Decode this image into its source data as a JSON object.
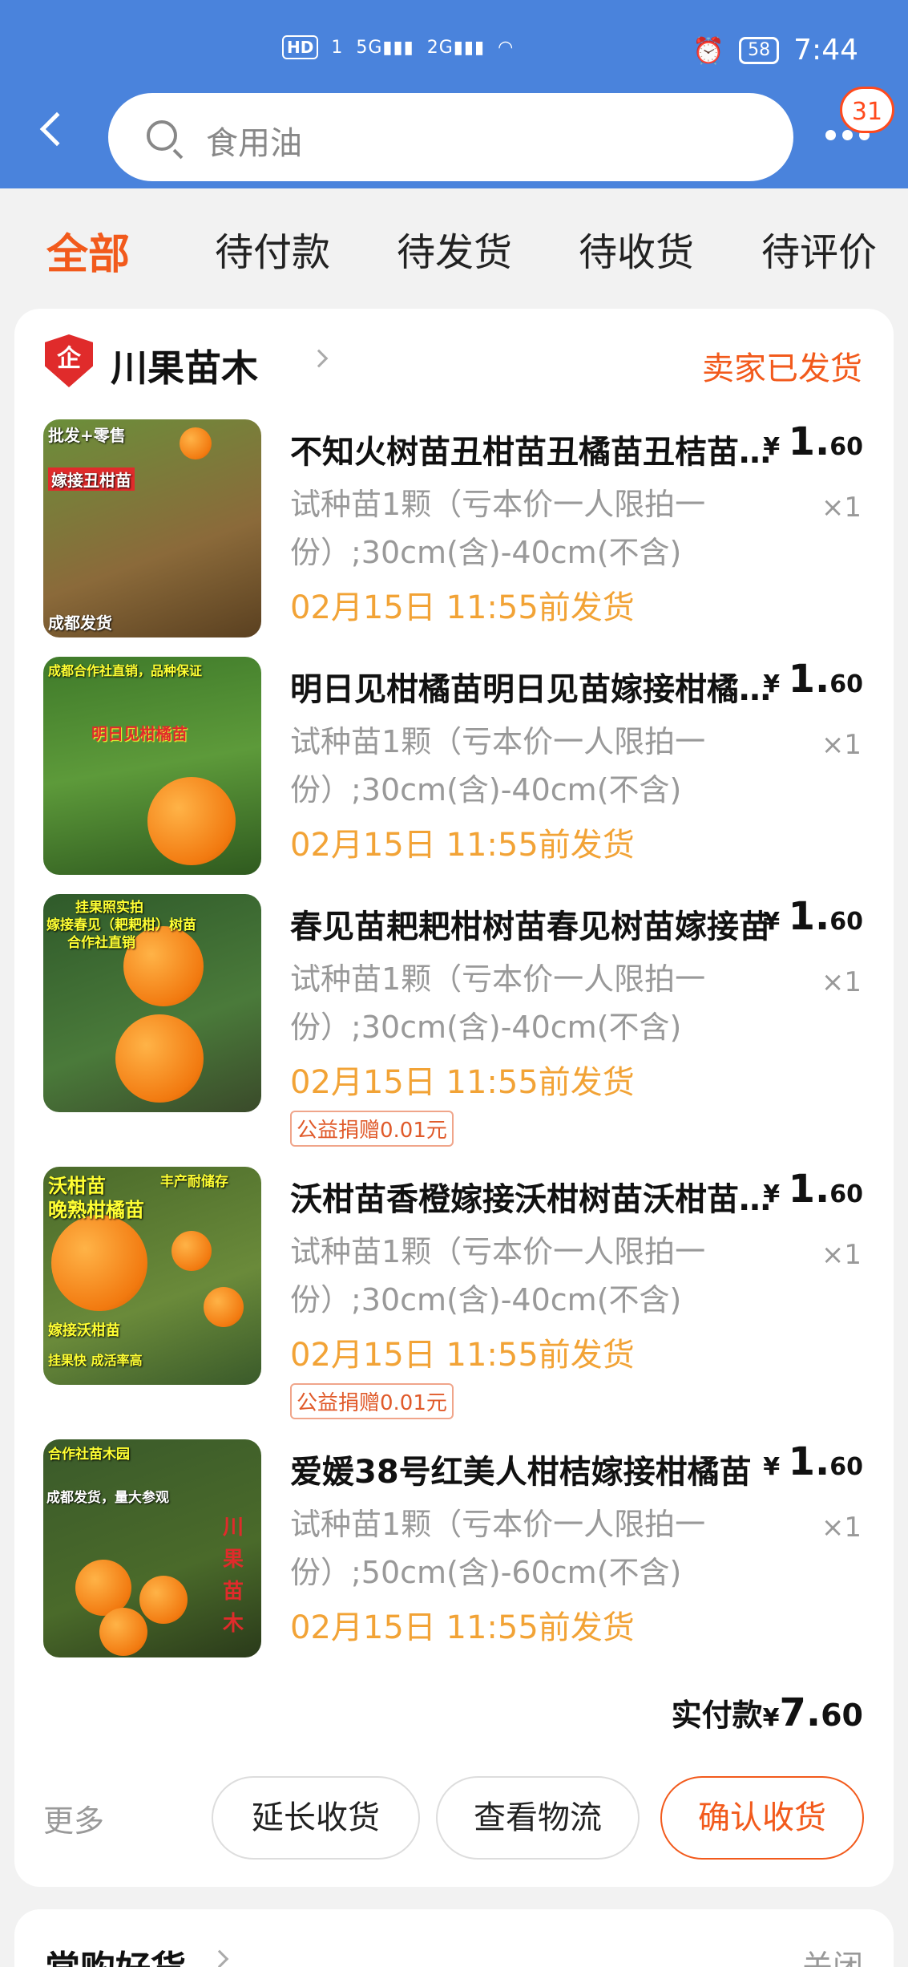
{
  "status_bar": {
    "hd": "HD",
    "sim": "1",
    "signal1": "5G",
    "signal2": "2G",
    "battery": "58",
    "time": "7:44"
  },
  "header": {
    "search_placeholder": "食用油",
    "notification_count": "31"
  },
  "tabs": [
    "全部",
    "待付款",
    "待发货",
    "待收货",
    "待评价"
  ],
  "shop": {
    "badge": "企",
    "name": "川果苗木",
    "status": "卖家已发货"
  },
  "items": [
    {
      "title": "不知火树苗丑柑苗丑橘苗丑桔苗嫁接苗",
      "price_symbol": "¥",
      "price_int": "1.",
      "price_dec": "60",
      "spec": "试种苗1颗（亏本价一人限拍一份）;30cm(含)-40cm(不含)",
      "qty": "×1",
      "ship": "02月15日 11:55前发货",
      "thumb_labels": [
        "批发+零售",
        "嫁接丑柑苗",
        "成都发货"
      ]
    },
    {
      "title": "明日见柑橘苗明日见苗嫁接柑橘树苗",
      "price_symbol": "¥",
      "price_int": "1.",
      "price_dec": "60",
      "spec": "试种苗1颗（亏本价一人限拍一份）;30cm(含)-40cm(不含)",
      "qty": "×1",
      "ship": "02月15日 11:55前发货",
      "thumb_labels": [
        "成都合作社直销，品种保证",
        "明日见柑橘苗"
      ]
    },
    {
      "title": "春见苗耙耙柑树苗春见树苗嫁接苗",
      "price_symbol": "¥",
      "price_int": "1.",
      "price_dec": "60",
      "spec": "试种苗1颗（亏本价一人限拍一份）;30cm(含)-40cm(不含)",
      "qty": "×1",
      "ship": "02月15日 11:55前发货",
      "donate": "公益捐赠0.01元",
      "thumb_labels": [
        "挂果照实拍",
        "嫁接春见（耙耙柑）树苗",
        "合作社直销"
      ]
    },
    {
      "title": "沃柑苗香橙嫁接沃柑树苗沃柑苗晚熟",
      "price_symbol": "¥",
      "price_int": "1.",
      "price_dec": "60",
      "spec": "试种苗1颗（亏本价一人限拍一份）;30cm(含)-40cm(不含)",
      "qty": "×1",
      "ship": "02月15日 11:55前发货",
      "donate": "公益捐赠0.01元",
      "thumb_labels": [
        "沃柑苗",
        "晚熟柑橘苗",
        "丰产耐储存",
        "嫁接沃柑苗",
        "挂果快 成活率高"
      ]
    },
    {
      "title": "爱媛38号红美人柑桔嫁接柑橘苗",
      "price_symbol": "¥",
      "price_int": "1.",
      "price_dec": "60",
      "spec": "试种苗1颗（亏本价一人限拍一份）;50cm(含)-60cm(不含)",
      "qty": "×1",
      "ship": "02月15日 11:55前发货",
      "thumb_labels": [
        "合作社苗木园",
        "成都发货，量大参观",
        "川果苗木"
      ]
    }
  ],
  "total": {
    "label": "实付款",
    "symbol": "¥",
    "int": "7.",
    "dec": "60"
  },
  "actions": {
    "more": "更多",
    "extend": "延长收货",
    "logistics": "查看物流",
    "confirm": "确认收货"
  },
  "bottom": {
    "title": "常购好货",
    "close": "关闭"
  }
}
